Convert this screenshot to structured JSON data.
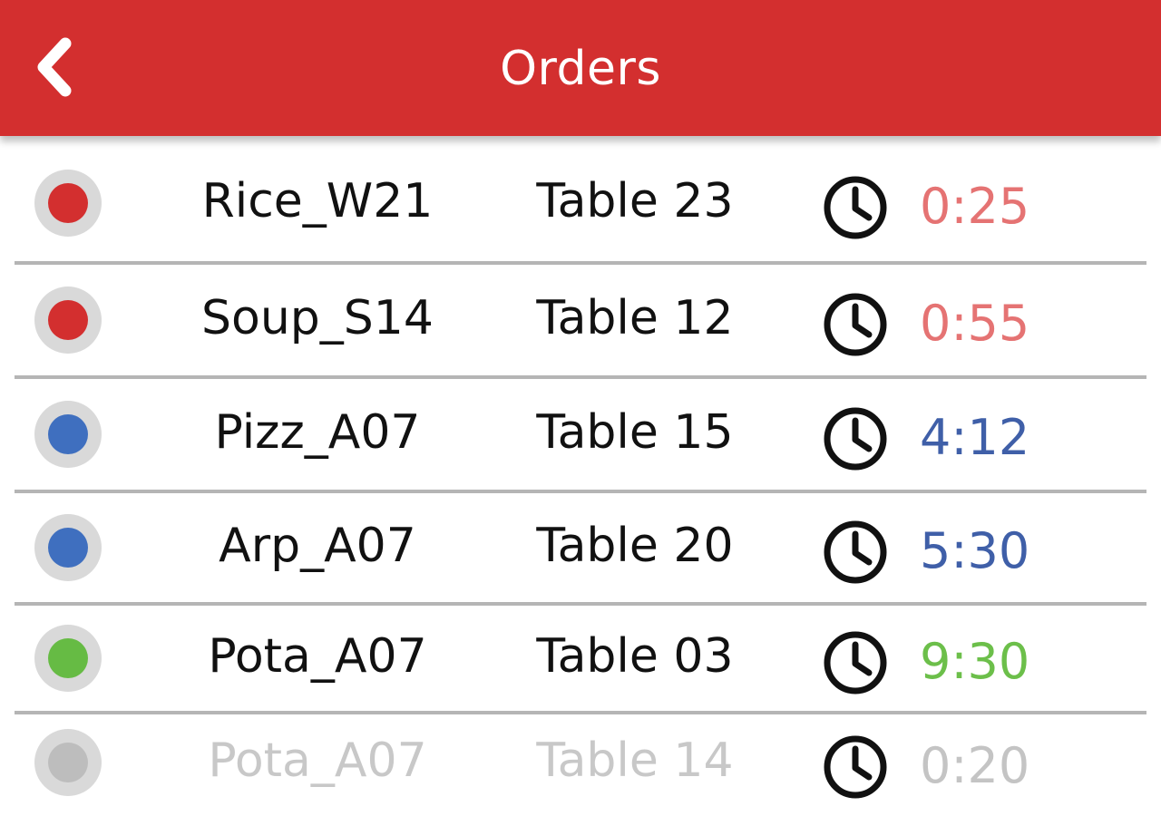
{
  "header": {
    "title": "Orders",
    "back_icon": "chevron-left-icon",
    "color": "#d32f2f"
  },
  "colors": {
    "red": "#d32f2f",
    "red_time": "#e57373",
    "blue": "#3f6fbf",
    "blue_time": "#3f5fa8",
    "green": "#66bb44",
    "green_time": "#6cbf4a",
    "gray": "#bdbdbd",
    "gray_time": "#c4c4c4"
  },
  "orders": [
    {
      "name": "Rice_W21",
      "table": "Table 23",
      "time": "0:25",
      "status": "red"
    },
    {
      "name": "Soup_S14",
      "table": "Table 12",
      "time": "0:55",
      "status": "red"
    },
    {
      "name": "Pizz_A07",
      "table": "Table 15",
      "time": "4:12",
      "status": "blue"
    },
    {
      "name": "Arp_A07",
      "table": "Table 20",
      "time": "5:30",
      "status": "blue"
    },
    {
      "name": "Pota_A07",
      "table": "Table 03",
      "time": "9:30",
      "status": "green"
    },
    {
      "name": "Pota_A07",
      "table": "Table 14",
      "time": "0:20",
      "status": "gray"
    }
  ]
}
